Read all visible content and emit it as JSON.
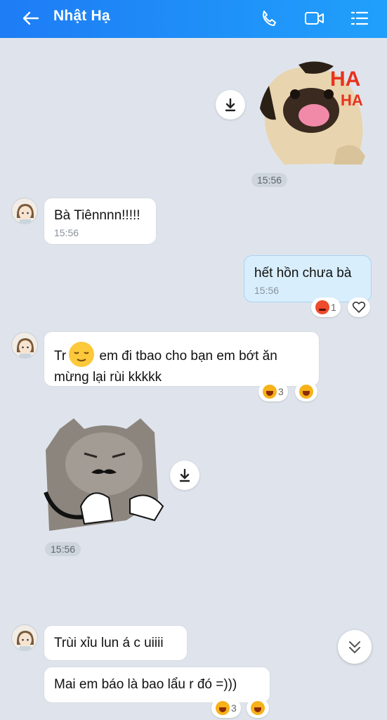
{
  "header": {
    "title": "Nhật Hạ",
    "icons": [
      "back-arrow-icon",
      "phone-icon",
      "video-call-icon",
      "menu-icon"
    ],
    "bg_color": "#1e7cf5"
  },
  "messages": {
    "sticker1_time": "15:56",
    "m1_text": "Bà Tiênnnn!!!!!",
    "m1_time": "15:56",
    "m2_text": "hết hồn chưa bà",
    "m2_time": "15:56",
    "m2_react_count": "1",
    "m3_text_a": "Tr",
    "m3_text_b": " em đi tbao cho bạn em bớt ăn mừng lại rùi kkkkk",
    "m3_react_count": "3",
    "sticker2_time": "15:56",
    "m4_text": "Trùi xỉu lun á c uiiii",
    "m5_text": "Mai em báo là bao lẩu r đó =)))",
    "m5_react_count": "3"
  },
  "sticker1_text": "HA HA"
}
